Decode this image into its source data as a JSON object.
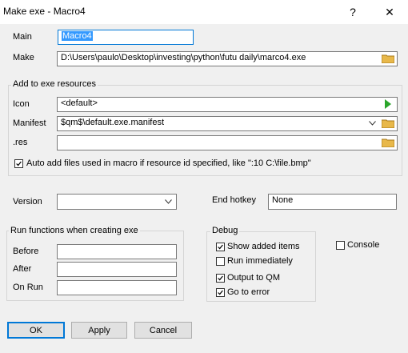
{
  "window": {
    "title": "Make exe - Macro4",
    "help_glyph": "?",
    "close_glyph": "✕"
  },
  "main": {
    "main_label": "Main",
    "main_value": "Macro4",
    "make_label": "Make",
    "make_value": "D:\\Users\\paulo\\Desktop\\investing\\python\\futu daily\\marco4.exe"
  },
  "resources": {
    "legend": "Add to exe resources",
    "icon_label": "Icon",
    "icon_value": "<default>",
    "manifest_label": "Manifest",
    "manifest_value": "$qm$\\default.exe.manifest",
    "res_label": ".res",
    "res_value": "",
    "auto_add_label": "Auto add files used in macro if resource id specified, like \":10 C:\\file.bmp\"",
    "auto_add_checked": true
  },
  "options": {
    "version_label": "Version",
    "version_value": "",
    "hotkey_label": "End hotkey",
    "hotkey_value": "None"
  },
  "run_functions": {
    "legend": "Run functions when creating exe",
    "before_label": "Before",
    "after_label": "After",
    "onrun_label": "On Run"
  },
  "debug": {
    "legend": "Debug",
    "items": [
      {
        "label": "Show added items",
        "checked": true
      },
      {
        "label": "Run immediately",
        "checked": false
      },
      {
        "label": "Output to QM",
        "checked": true
      },
      {
        "label": "Go to error",
        "checked": true
      }
    ],
    "console_label": "Console",
    "console_checked": false
  },
  "buttons": {
    "ok": "OK",
    "apply": "Apply",
    "cancel": "Cancel"
  }
}
